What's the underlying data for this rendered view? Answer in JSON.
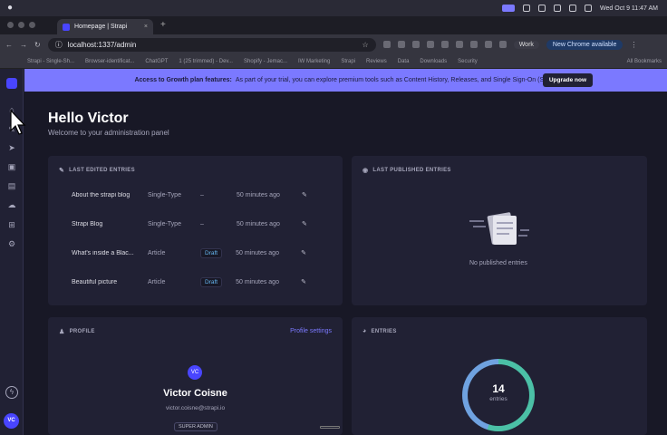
{
  "system": {
    "clock": "Wed Oct 9  11:47 AM"
  },
  "browser": {
    "tab_title": "Homepage | Strapi",
    "tab_close": "×",
    "new_tab": "+",
    "url": "localhost:1337/admin",
    "profile": "Work",
    "new_chrome": "New Chrome available",
    "bookmarks": [
      "Strapi - Single-Sh...",
      "Browser-identificat...",
      "ChatGPT",
      "1 (25 trimmed) - Dev...",
      "Shopify - Jemac...",
      "IW Marketing",
      "Strapi",
      "Reviews",
      "Data",
      "Downloads",
      "Security"
    ],
    "all_bookmarks": "All Bookmarks"
  },
  "banner": {
    "bold": "Access to Growth plan features:",
    "text": "As part of your trial, you can explore premium tools such as Content History, Releases, and Single Sign-On (SSO).",
    "button": "Upgrade now"
  },
  "page": {
    "title": "Hello Victor",
    "subtitle": "Welcome to your administration panel"
  },
  "last_edited": {
    "title": "LAST EDITED ENTRIES",
    "rows": [
      {
        "name": "About the strapi blog",
        "type": "Single-Type",
        "status": "–",
        "time": "50 minutes ago"
      },
      {
        "name": "Strapi Blog",
        "type": "Single-Type",
        "status": "–",
        "time": "50 minutes ago"
      },
      {
        "name": "What's inside a Blac...",
        "type": "Article",
        "status": "Draft",
        "time": "50 minutes ago"
      },
      {
        "name": "Beautiful picture",
        "type": "Article",
        "status": "Draft",
        "time": "50 minutes ago"
      }
    ]
  },
  "last_published": {
    "title": "LAST PUBLISHED ENTRIES",
    "empty": "No published entries"
  },
  "profile": {
    "title": "PROFILE",
    "settings_link": "Profile settings",
    "initials": "VC",
    "name": "Victor Coisne",
    "email": "victor.coisne@strapi.io",
    "role": "SUPER ADMIN"
  },
  "entries": {
    "title": "ENTRIES",
    "count": "14",
    "label": "entries"
  },
  "sidebar": {
    "avatar": "VC"
  }
}
